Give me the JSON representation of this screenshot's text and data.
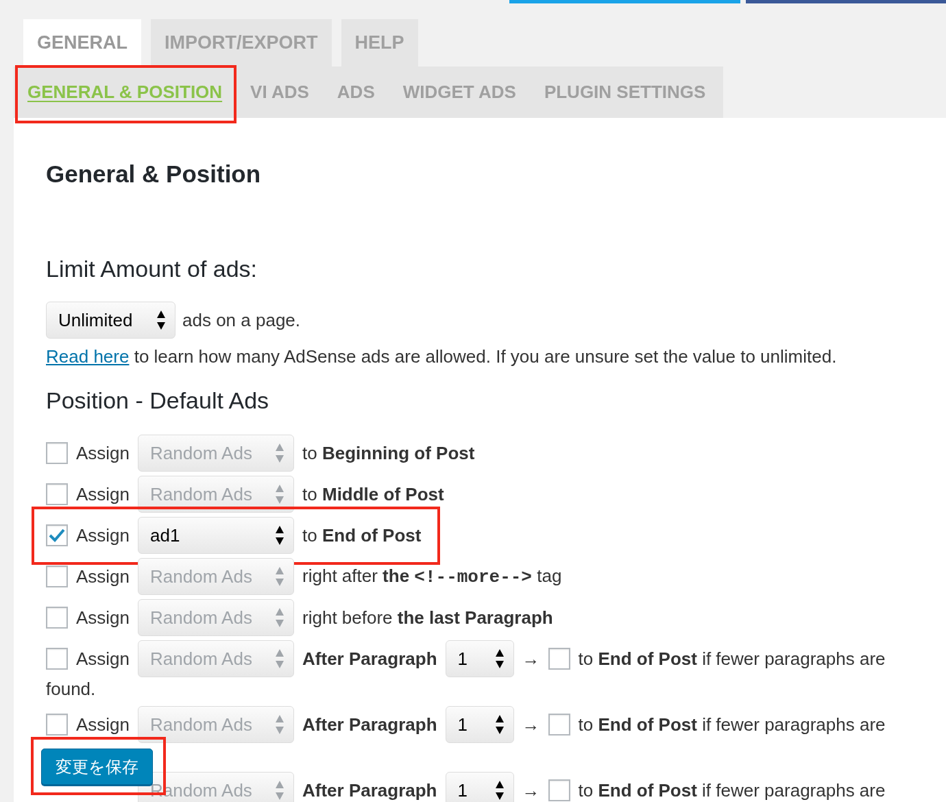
{
  "tabs": [
    {
      "label": "GENERAL",
      "selected": true
    },
    {
      "label": "IMPORT/EXPORT",
      "selected": false
    },
    {
      "label": "HELP",
      "selected": false
    }
  ],
  "subtabs": [
    {
      "label": "GENERAL & POSITION",
      "selected": true,
      "highlighted": true
    },
    {
      "label": "VI ADS",
      "selected": false,
      "highlighted": false
    },
    {
      "label": "ADS",
      "selected": false,
      "highlighted": false
    },
    {
      "label": "WIDGET ADS",
      "selected": false,
      "highlighted": false
    },
    {
      "label": "PLUGIN SETTINGS",
      "selected": false,
      "highlighted": false
    }
  ],
  "page_title": "General & Position",
  "limit": {
    "heading": "Limit Amount of ads:",
    "select": "Unlimited",
    "suffix": "ads on a page.",
    "link": "Read here",
    "note": "to learn how many AdSense ads are allowed. If you are unsure set the value to unlimited."
  },
  "position": {
    "heading": "Position - Default Ads",
    "rows": [
      {
        "kind": "simple",
        "checked": false,
        "label": "Assign",
        "select": "Random Ads",
        "disabled": true,
        "highlighted": false,
        "text": "to **Beginning of Post**"
      },
      {
        "kind": "simple",
        "checked": false,
        "label": "Assign",
        "select": "Random Ads",
        "disabled": true,
        "highlighted": false,
        "text": "to **Middle of Post**"
      },
      {
        "kind": "simple",
        "checked": true,
        "label": "Assign",
        "select": "ad1",
        "disabled": false,
        "highlighted": true,
        "text": "to **End of Post**"
      },
      {
        "kind": "simple",
        "checked": false,
        "label": "Assign",
        "select": "Random Ads",
        "disabled": true,
        "highlighted": false,
        "text": "right after **the**",
        "code": "<!--more-->",
        "text_after": "tag"
      },
      {
        "kind": "simple",
        "checked": false,
        "label": "Assign",
        "select": "Random Ads",
        "disabled": true,
        "highlighted": false,
        "text": "right before **the last Paragraph**"
      },
      {
        "kind": "paragraph",
        "checked": false,
        "label": "Assign",
        "select": "Random Ads",
        "disabled": true,
        "highlighted": false,
        "text": "After Paragraph",
        "number": "1",
        "arrow": "→",
        "fallback_checked": false,
        "fallback_text": "to **End of Post** if fewer paragraphs are",
        "continued": "found."
      },
      {
        "kind": "paragraph",
        "checked": false,
        "label": "Assign",
        "select": "Random Ads",
        "disabled": true,
        "highlighted": false,
        "text": "After Paragraph",
        "number": "1",
        "arrow": "→",
        "fallback_checked": false,
        "fallback_text": "to **End of Post** if fewer paragraphs are"
      },
      {
        "kind": "paragraph",
        "select": "Random Ads",
        "disabled": true,
        "highlighted": false,
        "text": "After Paragraph",
        "number": "1",
        "arrow": "→",
        "fallback_checked": false,
        "fallback_text": "to **End of Post** if fewer paragraphs are"
      }
    ]
  },
  "save_button": {
    "label": "変更を保存",
    "highlighted": true
  }
}
